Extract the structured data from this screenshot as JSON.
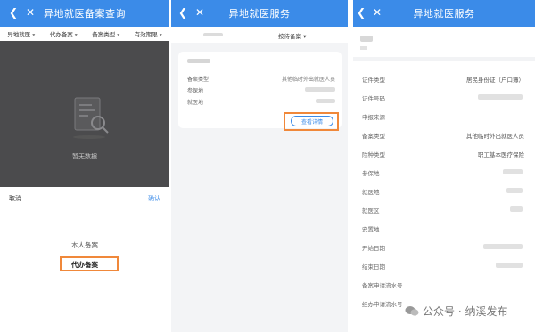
{
  "panel1": {
    "title": "异地就医备案查询",
    "filters": [
      "异地就医",
      "代办备案",
      "备案类型",
      "有效期限"
    ],
    "empty_text": "暂无数据",
    "sheet": {
      "cancel": "取消",
      "confirm": "确认",
      "options": [
        "本人备案",
        "代办备案"
      ]
    }
  },
  "panel2": {
    "title": "异地就医服务",
    "record_type": "按待备案",
    "card": {
      "rows": [
        {
          "label": "备案类型",
          "value": "其他临时外出就医人员"
        },
        {
          "label": "参保地",
          "value": ""
        },
        {
          "label": "就医地",
          "value": ""
        }
      ],
      "detail_button": "查看详情"
    }
  },
  "panel3": {
    "title": "异地就医服务",
    "fields": [
      {
        "label": "证件类型",
        "value": "居民身份证（户口簿）"
      },
      {
        "label": "证件号码",
        "value": ""
      },
      {
        "label": "申报来源",
        "value": ""
      },
      {
        "label": "备案类型",
        "value": "其他临时外出就医人员"
      },
      {
        "label": "险种类型",
        "value": "职工基本医疗保险"
      },
      {
        "label": "参保地",
        "value": ""
      },
      {
        "label": "就医地",
        "value": ""
      },
      {
        "label": "就医区",
        "value": ""
      },
      {
        "label": "安置地",
        "value": ""
      },
      {
        "label": "开始日期",
        "value": ""
      },
      {
        "label": "结束日期",
        "value": ""
      },
      {
        "label": "备案申请流水号",
        "value": ""
      },
      {
        "label": "经办申请流水号",
        "value": ""
      }
    ]
  },
  "watermark": "公众号 · 纳溪发布",
  "colors": {
    "nav_blue": "#3b8be8",
    "highlight_orange": "#f0883a"
  },
  "icons": {
    "back": "chevron-left-icon",
    "close": "close-icon"
  }
}
